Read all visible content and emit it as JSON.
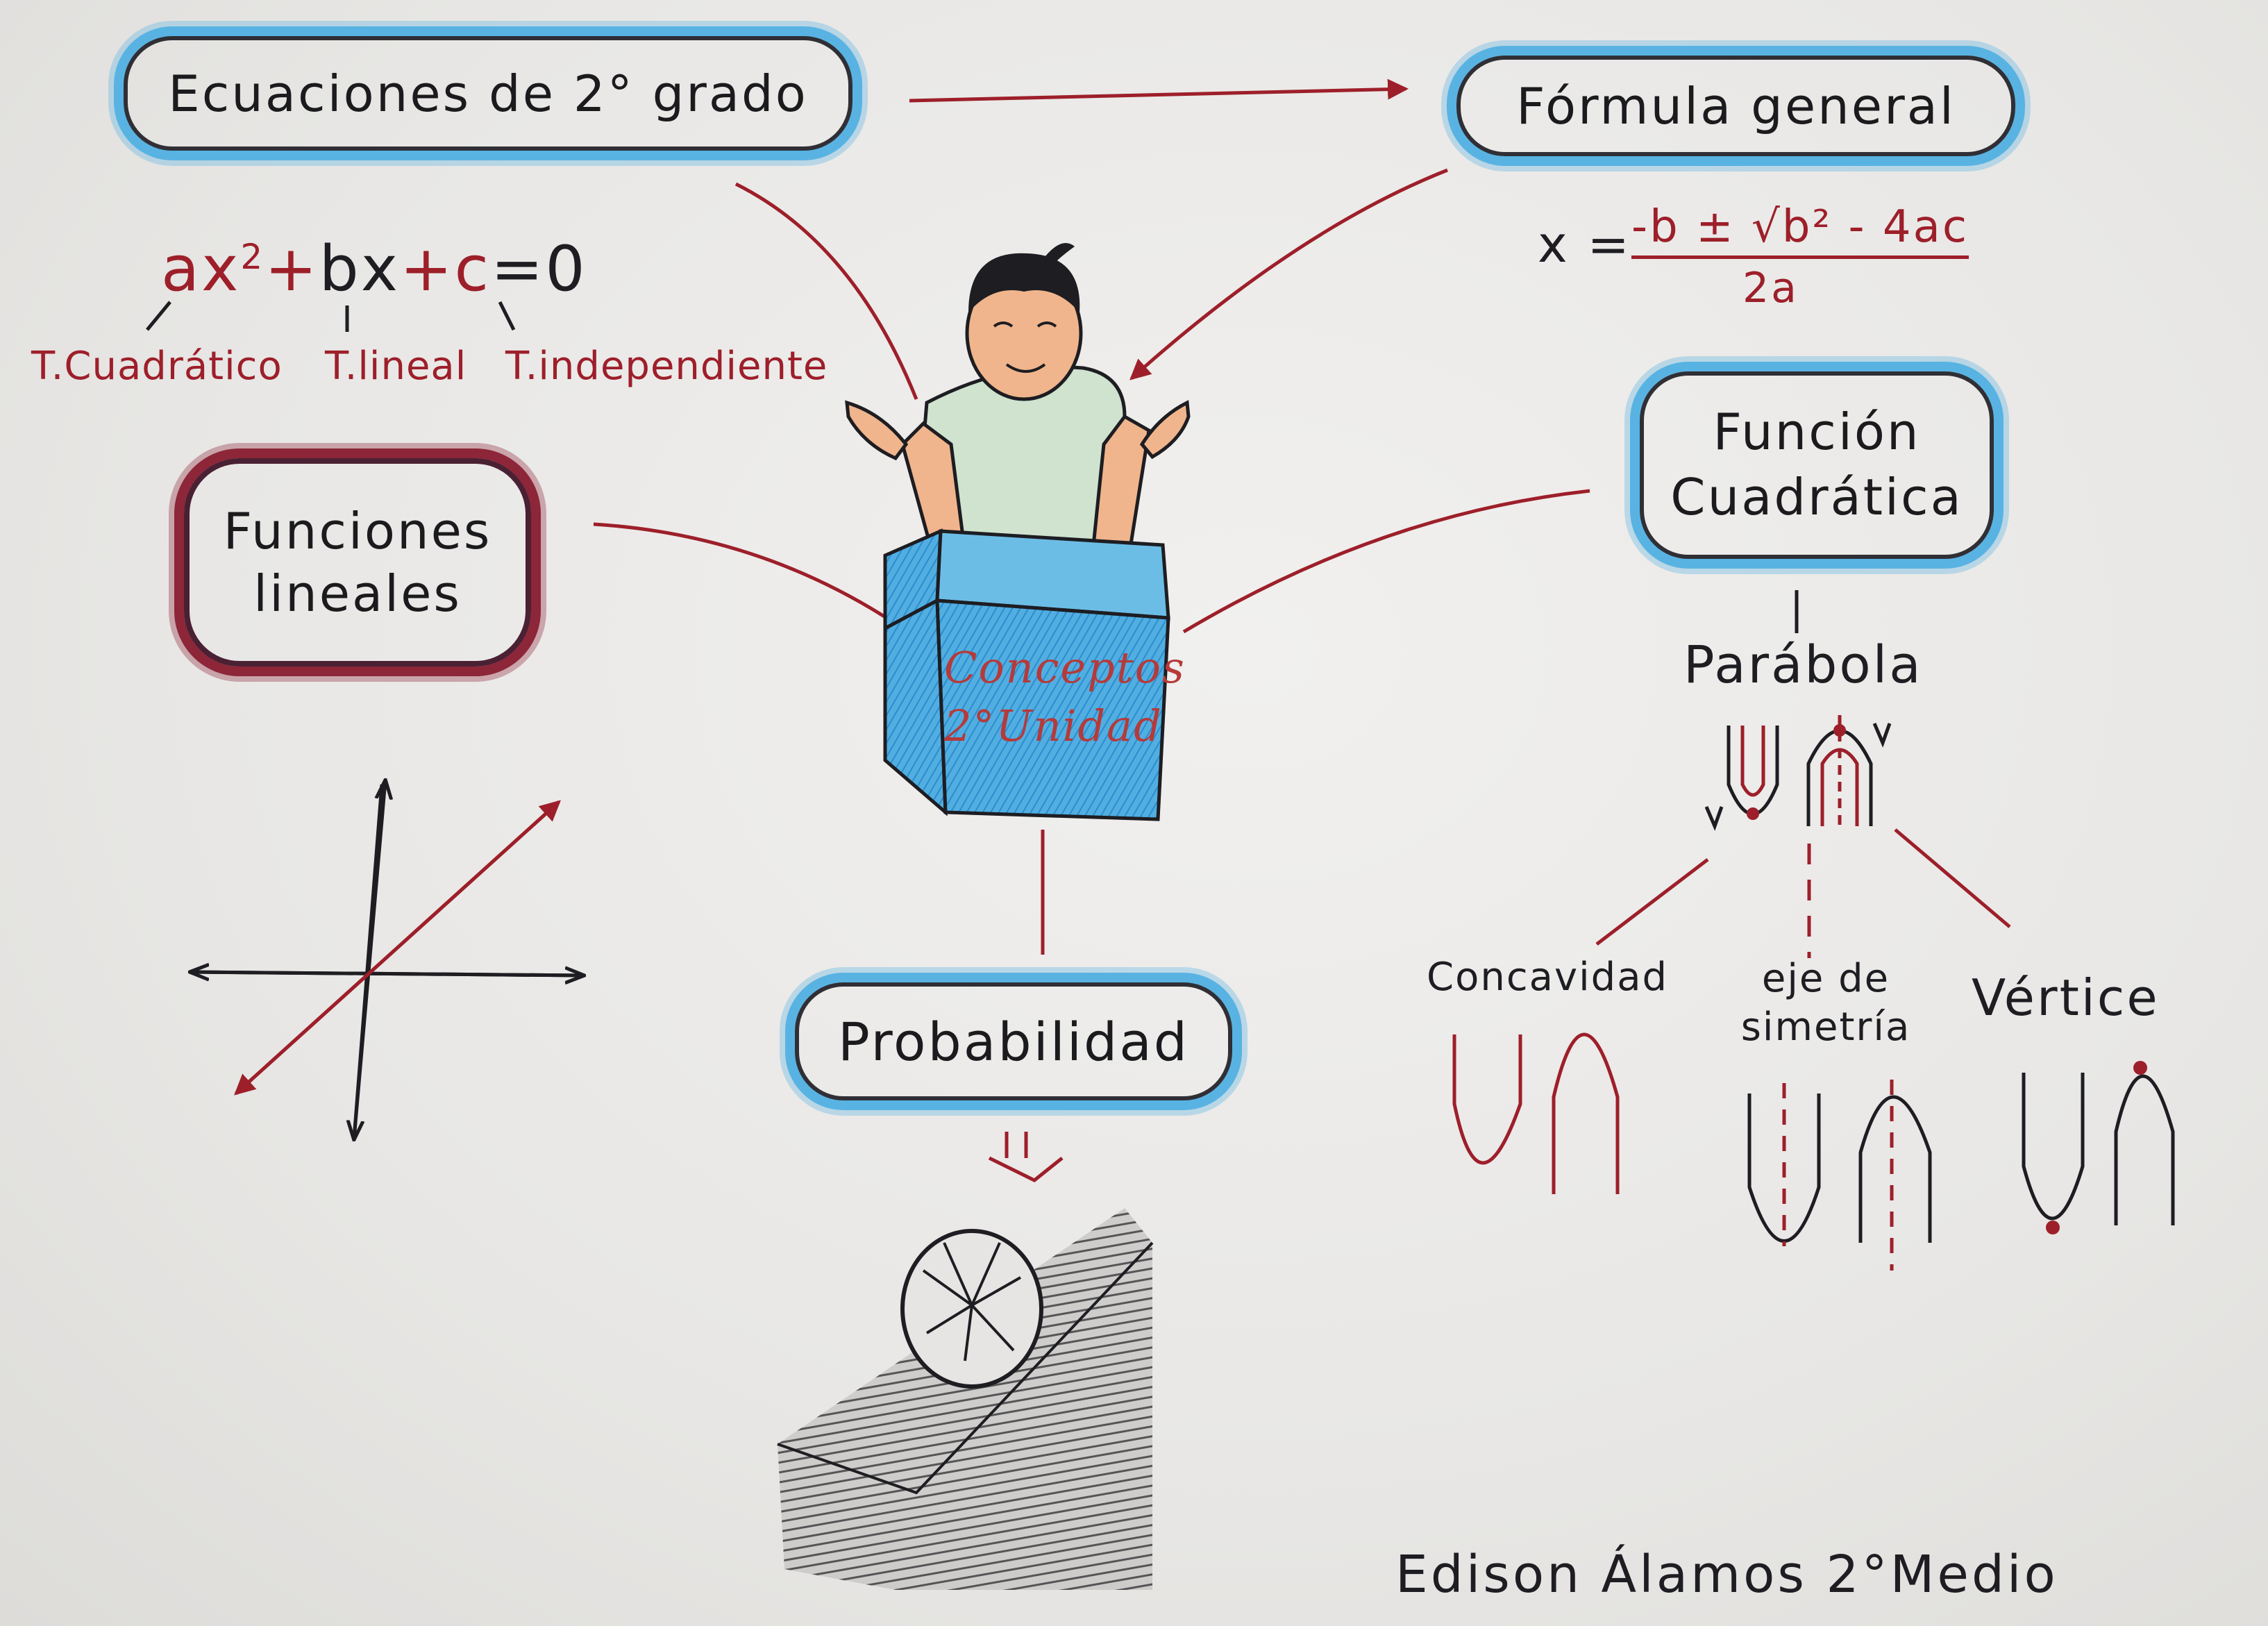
{
  "colors": {
    "ink": "#1d1d22",
    "red_ink": "#9d1f2a",
    "blue_cloud": "#58b3e3",
    "red_cloud": "#8c2638",
    "box_blue": "#3a9fd8",
    "skin": "#f0b58c",
    "shirt": "#cfe3cf"
  },
  "nodes": {
    "ecuaciones": "Ecuaciones de 2° grado",
    "formula_general": "Fórmula general",
    "funciones_lineales_line1": "Funciones",
    "funciones_lineales_line2": "lineales",
    "funcion_cuadratica_line1": "Función",
    "funcion_cuadratica_line2": "Cuadrática",
    "probabilidad": "Probabilidad",
    "center_line1": "Conceptos",
    "center_line2": "2°Unidad"
  },
  "equation": {
    "parts": [
      "ax",
      "2",
      "+",
      "b",
      "x",
      "+",
      "c",
      "=0"
    ],
    "terms": [
      "T.Cuadrático",
      "T.lineal",
      "T.independiente"
    ]
  },
  "formula": {
    "lhs": "x =",
    "numerator": "-b ± √b² - 4ac",
    "denominator": "2a"
  },
  "parabola": {
    "title": "Parábola",
    "concepts": [
      "Concavidad",
      "eje de simetría",
      "Vértice"
    ]
  },
  "signature": "Edison Álamos 2°Medio",
  "icons": [
    "person-shrug-icon",
    "cube-icon",
    "cartesian-axes-icon",
    "parabola-icon",
    "ball-icon"
  ]
}
